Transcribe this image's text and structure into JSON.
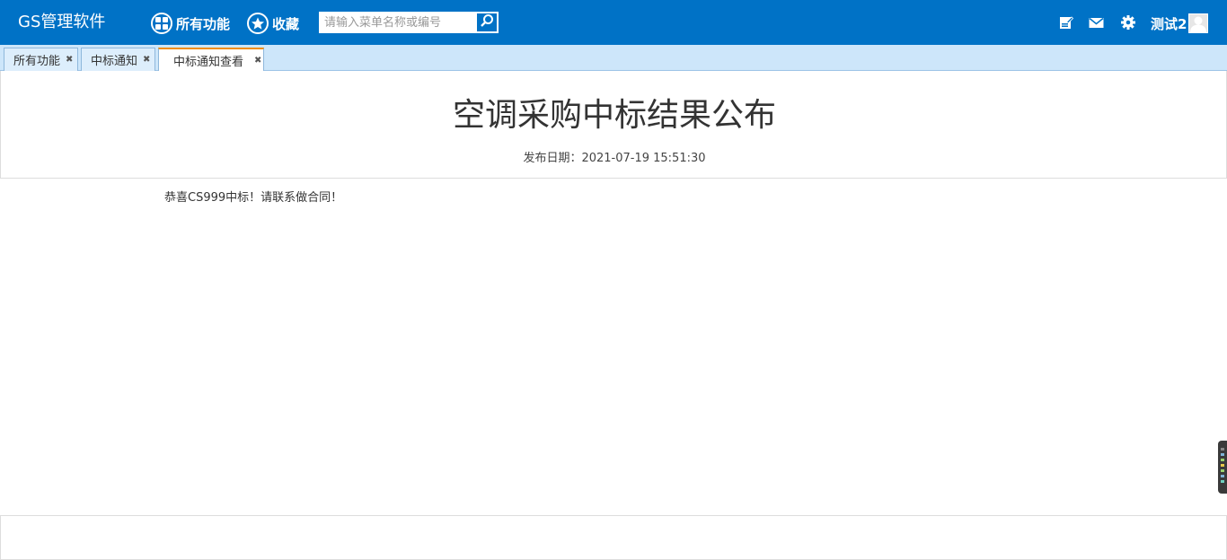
{
  "app": {
    "title": "GS管理软件"
  },
  "nav": {
    "all_functions": "所有功能",
    "favorites": "收藏"
  },
  "search": {
    "placeholder": "请输入菜单名称或编号"
  },
  "user": {
    "name": "测试2"
  },
  "tabs": [
    {
      "label": "所有功能",
      "close": "✖"
    },
    {
      "label": "中标通知",
      "close": "✖"
    },
    {
      "label": "中标通知查看",
      "close": "✖"
    }
  ],
  "document": {
    "title": "空调采购中标结果公布",
    "date_line": "发布日期：2021-07-19 15:51:30",
    "body": "恭喜CS999中标！请联系做合同！"
  },
  "colors": {
    "topbar": "#0072c6",
    "tabbar": "#cde6fa",
    "active_tab_accent": "#f08c00"
  },
  "icons": [
    "apps-grid-icon",
    "star-icon",
    "search-icon",
    "edit-icon",
    "mail-icon",
    "gear-icon",
    "user-avatar-icon",
    "close-icon"
  ]
}
